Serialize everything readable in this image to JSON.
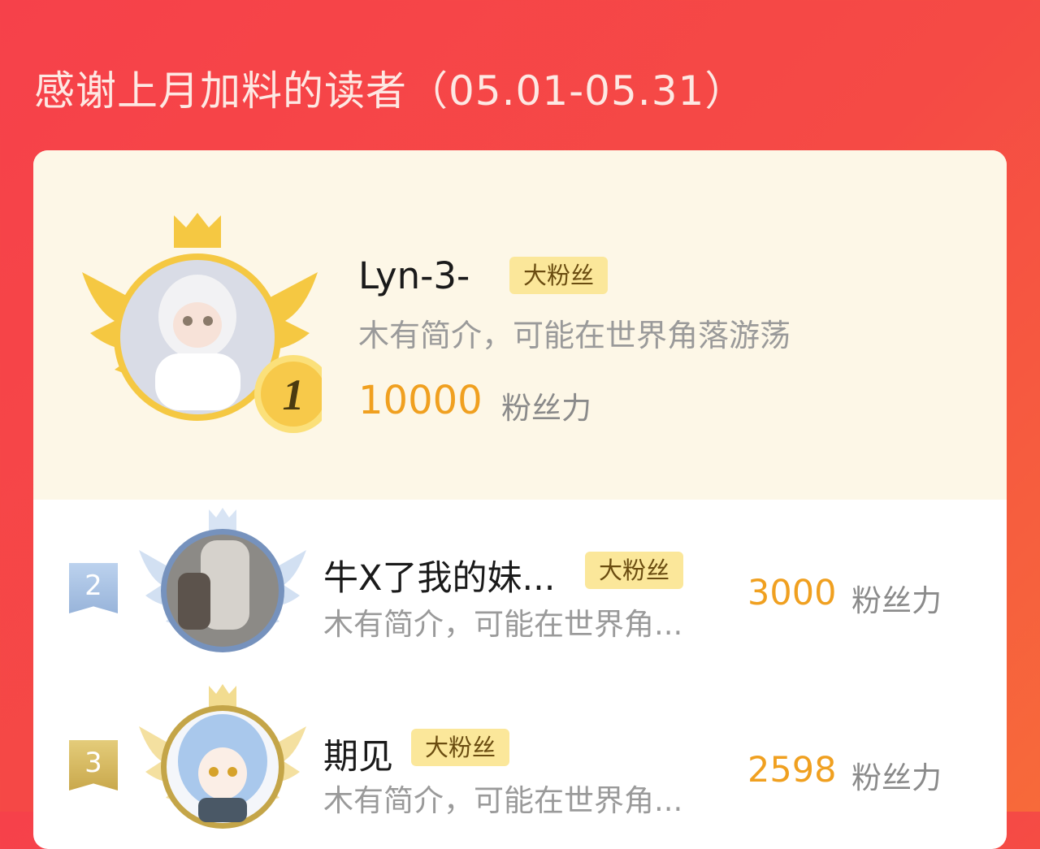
{
  "header": {
    "title": "感谢上月加料的读者（05.01-05.31）"
  },
  "ranking": [
    {
      "rank": "1",
      "name": "Lyn-3-",
      "badge": "大粉丝",
      "bio": "木有简介，可能在世界角落游荡",
      "score": "10000",
      "unit": "粉丝力"
    },
    {
      "rank": "2",
      "name": "牛X了我的妹...",
      "badge": "大粉丝",
      "bio": "木有简介，可能在世界角...",
      "score": "3000",
      "unit": "粉丝力"
    },
    {
      "rank": "3",
      "name": "期见",
      "badge": "大粉丝",
      "bio": "木有简介，可能在世界角...",
      "score": "2598",
      "unit": "粉丝力"
    }
  ],
  "colors": {
    "background": "#f6414a",
    "card_top": "#fdf7e7",
    "gold": "#f5c842",
    "silver": "#aac4e4",
    "bronze": "#d8b860",
    "score": "#f0a020",
    "badge": "#fbe79a"
  },
  "icons": [
    "crown-icon",
    "wing-icon",
    "rank-medal-icon",
    "rank-ribbon-icon",
    "avatar"
  ]
}
